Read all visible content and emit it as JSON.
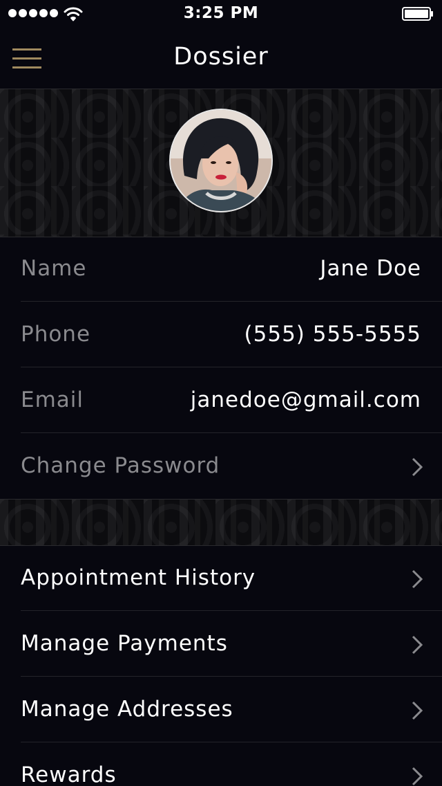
{
  "status_bar": {
    "time": "3:25 PM",
    "signal_dots": 5
  },
  "nav": {
    "title": "Dossier"
  },
  "profile": {
    "fields": [
      {
        "label": "Name",
        "value": "Jane Doe"
      },
      {
        "label": "Phone",
        "value": "(555) 555-5555"
      },
      {
        "label": "Email",
        "value": "janedoe@gmail.com"
      }
    ],
    "change_password_label": "Change Password"
  },
  "menu": {
    "items": [
      {
        "label": "Appointment History"
      },
      {
        "label": "Manage Payments"
      },
      {
        "label": "Manage Addresses"
      },
      {
        "label": "Rewards"
      }
    ]
  },
  "colors": {
    "background": "#07070f",
    "accent_gold": "#a08a5f",
    "label_gray": "#8a8a8e",
    "divider": "#24242a"
  },
  "icons": {
    "menu": "hamburger-menu-icon",
    "chevron": "chevron-right-icon",
    "wifi": "wifi-icon",
    "battery": "battery-icon"
  }
}
